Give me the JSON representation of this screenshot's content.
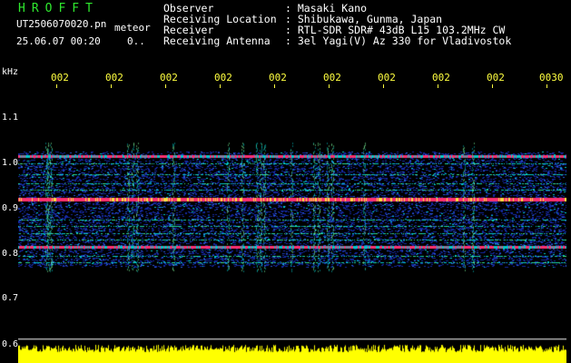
{
  "header": {
    "logo": "HROFFT",
    "filename": "UT2506070020.pn",
    "mode": "meteor",
    "datetime": "25.06.07 00:20",
    "dots": "0.."
  },
  "info": [
    {
      "label": "Observer",
      "value": ": Masaki Kano"
    },
    {
      "label": "Receiving Location",
      "value": ": Shibukawa, Gunma, Japan"
    },
    {
      "label": "Receiver",
      "value": ": RTL-SDR SDR# 43dB L15 103.2MHz CW"
    },
    {
      "label": "Receiving Antenna",
      "value": ": 3el Yagi(V) Az 330 for Vladivostok"
    }
  ],
  "axes": {
    "y_unit": "kHz",
    "y_ticks": [
      "1.1",
      "1.0",
      "0.9",
      "0.8",
      "0.7",
      "0.6"
    ],
    "x_ticks": [
      "002",
      "002",
      "002",
      "002",
      "002",
      "002",
      "002",
      "002",
      "002",
      "0030"
    ]
  },
  "spectrum": {
    "freq_range_khz": [
      0.6,
      1.14
    ],
    "signal_band_khz": [
      0.77,
      1.025
    ],
    "strong_lines_khz": [
      0.815,
      0.92,
      1.015
    ],
    "colors": {
      "background": "#000000",
      "noise": "#1428a0",
      "mid": "#00c8c8",
      "hot": "#ff3070",
      "amplitude": "#ffff00"
    }
  }
}
